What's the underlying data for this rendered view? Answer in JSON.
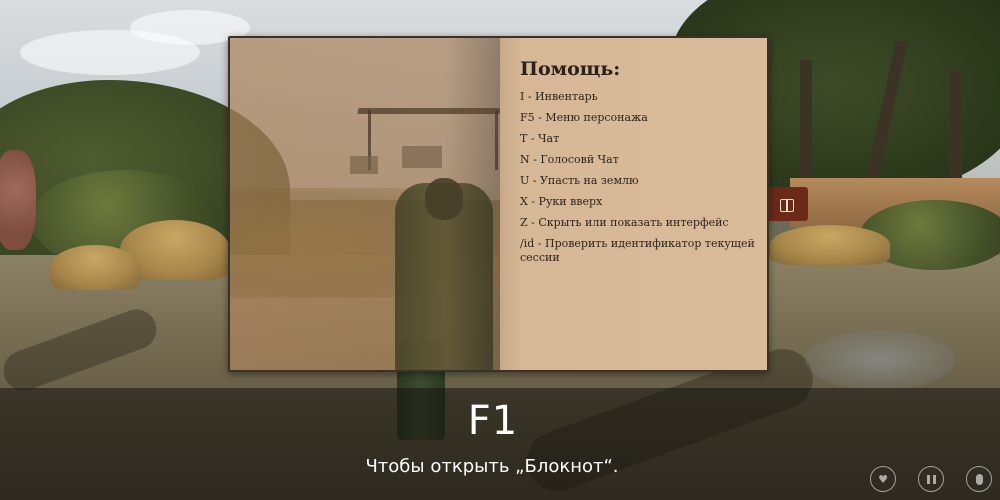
{
  "notebook": {
    "title": "Помощь:",
    "items": [
      "I - Инвентарь",
      "F5 - Меню персонажа",
      "T - Чат",
      "N - Голосовй Чат",
      "U - Упасть на землю",
      "X - Руки вверх",
      "Z - Скрыть или показать интерфейс",
      "/id - Проверить идентификатор текущей сессии"
    ],
    "side_tab_icon": "book-icon"
  },
  "hint": {
    "key": "F1",
    "text": "Чтобы открыть „Блокнот“."
  },
  "controls": {
    "icons": [
      "heart-icon",
      "pause-icon",
      "mic-icon"
    ]
  },
  "colors": {
    "page": "#d9bb99",
    "tab": "#6a2a15",
    "text": "#2e241b"
  }
}
